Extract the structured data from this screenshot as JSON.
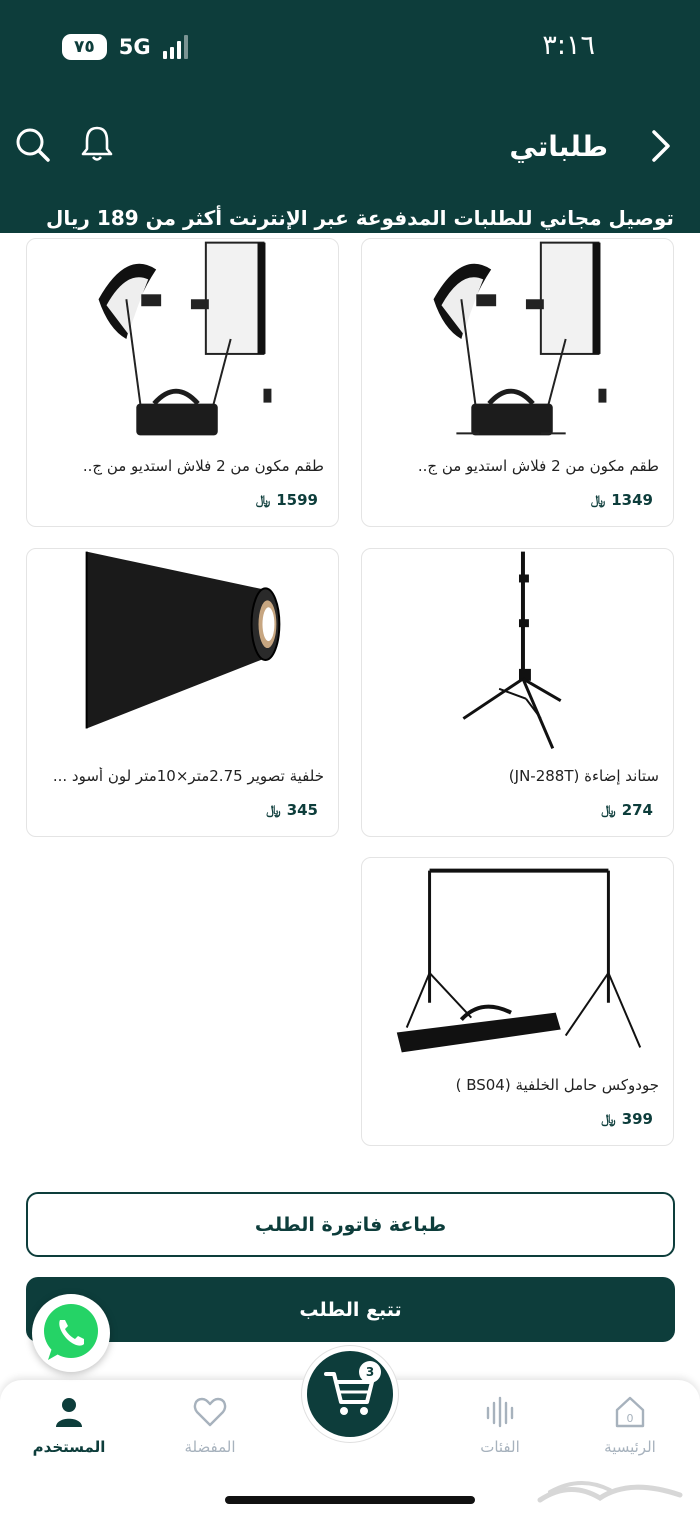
{
  "status_bar": {
    "time": "٣:١٦",
    "battery": "٧٥",
    "network": "5G"
  },
  "header": {
    "title": "طلباتي",
    "promo": "توصيل مجاني للطلبات المدفوعة عبر الإنترنت أكثر من 189 ريال"
  },
  "currency_symbol": "﷼",
  "products": [
    {
      "name": "طقم مكون من 2 فلاش استديو من ج..",
      "price": "1349",
      "image": "flash-studio-kit"
    },
    {
      "name": "طقم مكون من 2 فلاش استديو من ج..",
      "price": "1599",
      "image": "flash-studio-kit"
    },
    {
      "name": "ستاند إضاءة (JN-288T)",
      "price": "274",
      "image": "light-stand"
    },
    {
      "name": "خلفية تصوير 2.75متر×10متر لون أسود ...",
      "price": "345",
      "image": "black-paper-backdrop"
    },
    {
      "name": "جودوكس حامل الخلفية (BS04 )",
      "price": "399",
      "image": "backdrop-stand"
    }
  ],
  "actions": {
    "print_invoice": "طباعة فاتورة الطلب",
    "track_order": "تتبع الطلب"
  },
  "bottom_nav": {
    "home": "الرئيسية",
    "home_badge": "0",
    "categories": "الفئات",
    "favorites": "المفضلة",
    "user": "المستخدم",
    "cart_count": "3"
  },
  "colors": {
    "brand": "#0d3d3b",
    "inactive": "#a7b2bd",
    "whatsapp": "#25d366"
  }
}
